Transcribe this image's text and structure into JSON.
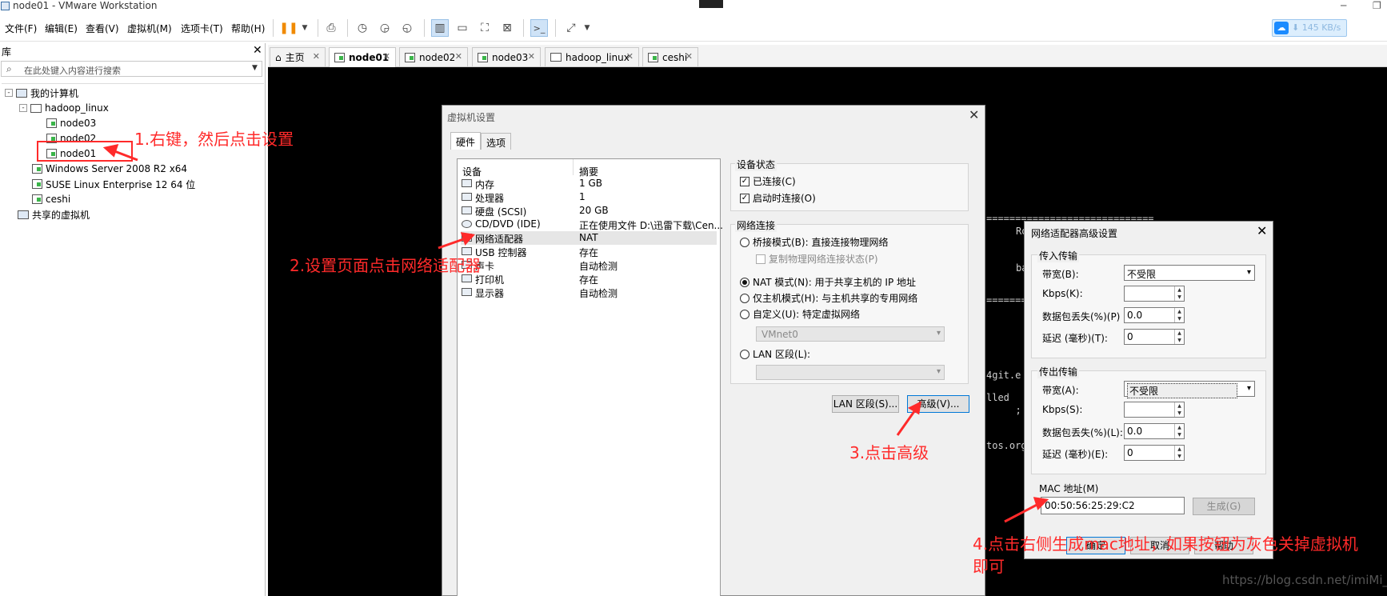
{
  "window": {
    "title": "node01 - VMware Workstation",
    "minimize": "─",
    "restore": "❐"
  },
  "menu": [
    "文件(F)",
    "编辑(E)",
    "查看(V)",
    "虚拟机(M)",
    "选项卡(T)",
    "帮助(H)"
  ],
  "netspeed": {
    "icon": "☁",
    "value": "⬇ 145 KB/s"
  },
  "library": {
    "title": "库",
    "close": "✕",
    "search_placeholder": "在此处键入内容进行搜索",
    "search_icon": "⌕",
    "caret": "▼",
    "tree": [
      {
        "label": "我的计算机",
        "exp": "-",
        "icon": "pc"
      },
      {
        "label": "hadoop_linux",
        "exp": "-",
        "icon": "folder"
      },
      {
        "label": "node03",
        "icon": "vm"
      },
      {
        "label": "node02",
        "icon": "vm"
      },
      {
        "label": "node01",
        "icon": "vm"
      },
      {
        "label": "Windows Server 2008 R2 x64",
        "icon": "vm"
      },
      {
        "label": "SUSE Linux Enterprise 12 64 位",
        "icon": "vm"
      },
      {
        "label": "ceshi",
        "icon": "vm"
      },
      {
        "label": "共享的虚拟机",
        "icon": "pc"
      }
    ]
  },
  "tabs": [
    {
      "label": "主页",
      "icon": "⌂"
    },
    {
      "label": "node01",
      "active": true
    },
    {
      "label": "node02"
    },
    {
      "label": "node03"
    },
    {
      "label": "hadoop_linux"
    },
    {
      "label": "ceshi"
    }
  ],
  "tab_close": "✕",
  "console_lines": [
    "=============================",
    "Ro",
    "ba",
    "=============================",
    "4git.e",
    "lled",
    "  ; ",
    "tos.org"
  ],
  "vm_settings": {
    "title": "虚拟机设置",
    "close": "✕",
    "tabs": [
      "硬件",
      "选项"
    ],
    "col_device": "设备",
    "col_summary": "摘要",
    "devices": [
      {
        "name": "内存",
        "summary": "1 GB"
      },
      {
        "name": "处理器",
        "summary": "1"
      },
      {
        "name": "硬盘 (SCSI)",
        "summary": "20 GB"
      },
      {
        "name": "CD/DVD (IDE)",
        "summary": "正在使用文件 D:\\迅雷下载\\Cen..."
      },
      {
        "name": "网络适配器",
        "summary": "NAT"
      },
      {
        "name": "USB 控制器",
        "summary": "存在"
      },
      {
        "name": "声卡",
        "summary": "自动检测"
      },
      {
        "name": "打印机",
        "summary": "存在"
      },
      {
        "name": "显示器",
        "summary": "自动检测"
      }
    ],
    "device_status_title": "设备状态",
    "connected": "已连接(C)",
    "connect_on_power": "启动时连接(O)",
    "network_title": "网络连接",
    "bridged": "桥接模式(B): 直接连接物理网络",
    "replicate": "复制物理网络连接状态(P)",
    "nat": "NAT 模式(N): 用于共享主机的 IP 地址",
    "hostonly": "仅主机模式(H): 与主机共享的专用网络",
    "custom": "自定义(U): 特定虚拟网络",
    "vmnet": "VMnet0",
    "lan": "LAN 区段(L):",
    "lan_btn": "LAN 区段(S)...",
    "advanced_btn": "高级(V)...",
    "arrow": "▾"
  },
  "advanced": {
    "title": "网络适配器高级设置",
    "close": "✕",
    "incoming_title": "传入传输",
    "outgoing_title": "传出传输",
    "bandwidth_in_label": "带宽(B):",
    "bandwidth_out_label": "带宽(A):",
    "bandwidth_value": "不受限",
    "kbps_in_label": "Kbps(K):",
    "kbps_out_label": "Kbps(S):",
    "loss_in_label": "数据包丢失(%)(P)",
    "loss_out_label": "数据包丢失(%)(L):",
    "loss_value": "0.0",
    "latency_in_label": "延迟 (毫秒)(T):",
    "latency_out_label": "延迟 (毫秒)(E):",
    "latency_value": "0",
    "mac_title": "MAC 地址(M)",
    "mac_value": "00:50:56:25:29:C2",
    "generate": "生成(G)",
    "ok": "确定",
    "cancel": "取消",
    "help": "帮助"
  },
  "annotations": {
    "step1": "1.右键，然后点击设置",
    "step2": "2.设置页面点击网络适配器",
    "step3": "3.点击高级",
    "step4_line1": "4.点击右侧生成mac地址，如果按钮为灰色关掉虚拟机",
    "step4_line2": "即可"
  },
  "watermark": "https://blog.csdn.net/imiMi_",
  "colors": {
    "annotation": "#ff2a2a",
    "console_bg": "#000000",
    "accent": "#0078d7"
  }
}
